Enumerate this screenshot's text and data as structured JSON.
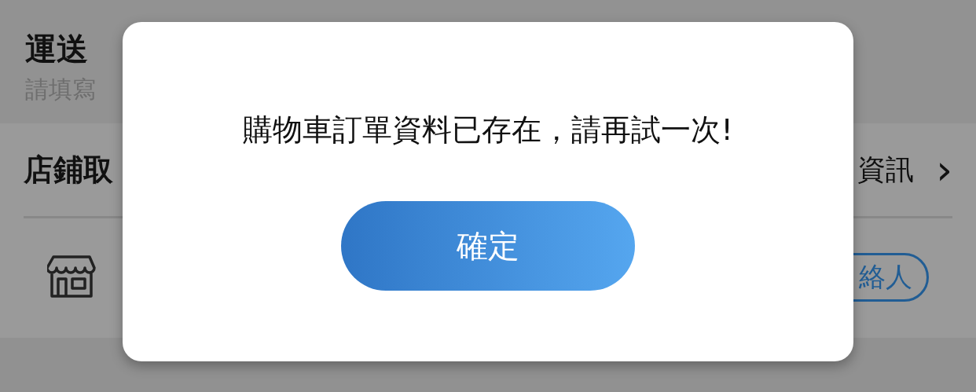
{
  "page": {
    "title": "運送",
    "subtitle": "請填寫",
    "store_pickup": {
      "label": "店鋪取",
      "info_link": "資訊",
      "chevron": "›",
      "contact_button": "絡人"
    }
  },
  "dialog": {
    "message": "購物車訂單資料已存在，請再試一次!",
    "confirm_button": "確定"
  }
}
